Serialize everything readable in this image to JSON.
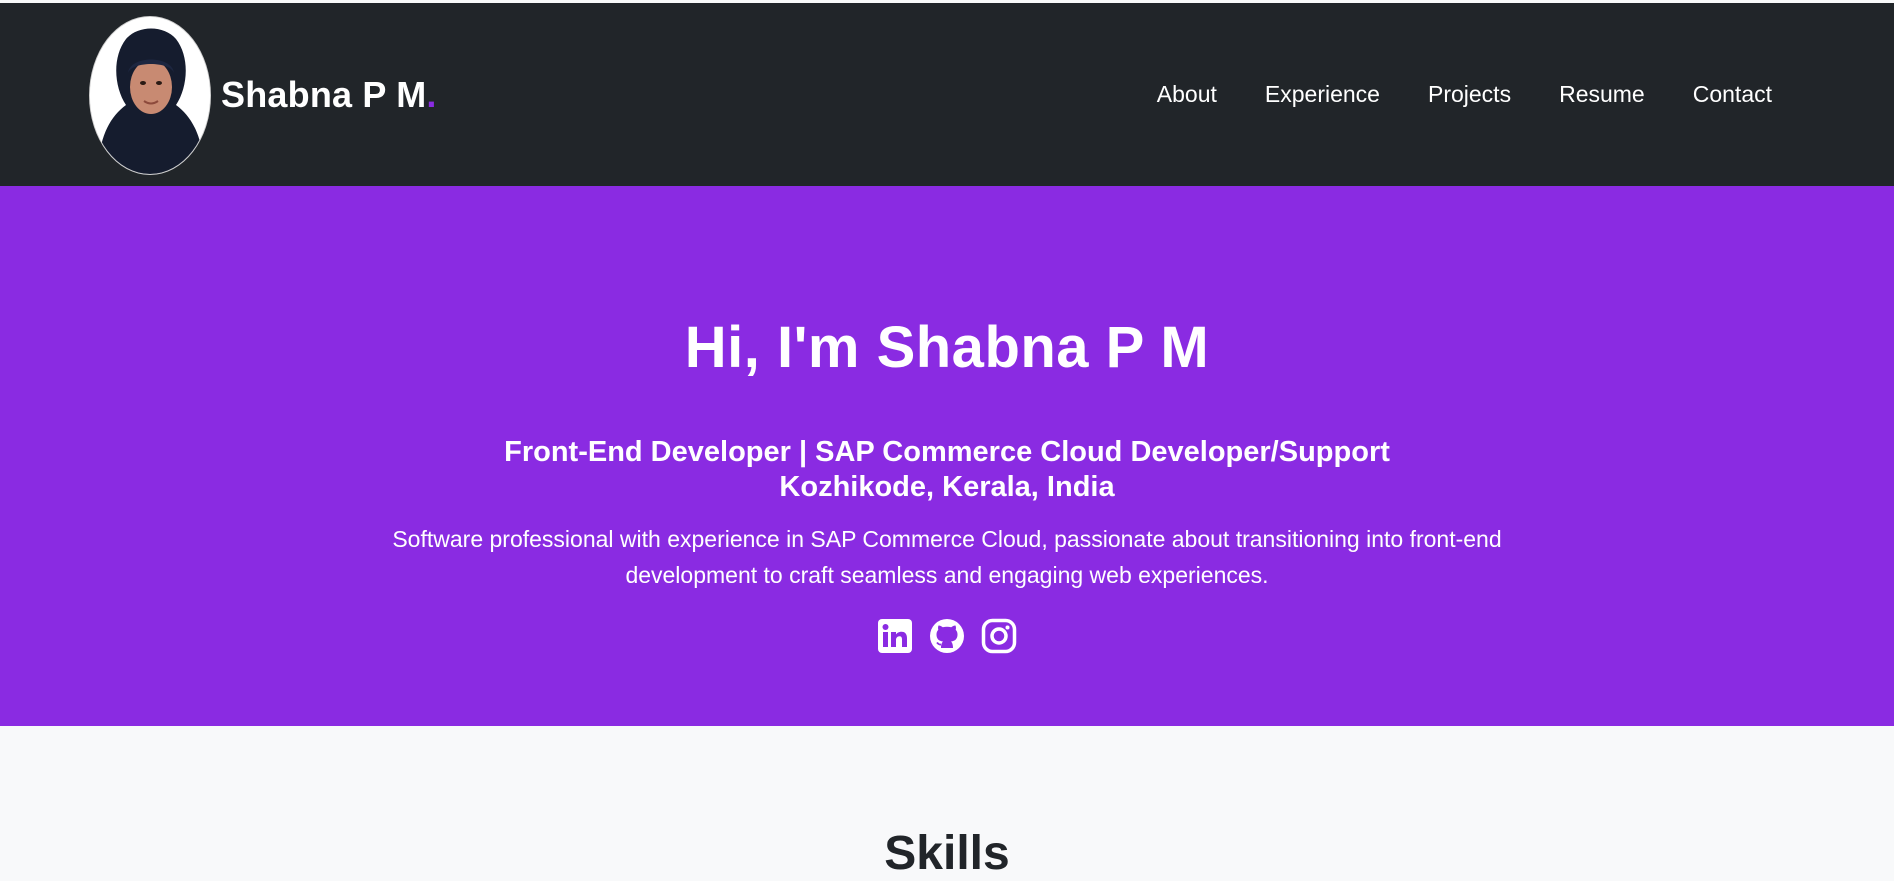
{
  "brand": {
    "name": "Shabna P M",
    "dot": "."
  },
  "nav": {
    "items": [
      {
        "label": "About"
      },
      {
        "label": "Experience"
      },
      {
        "label": "Projects"
      },
      {
        "label": "Resume"
      },
      {
        "label": "Contact"
      }
    ]
  },
  "hero": {
    "title": "Hi, I'm Shabna P M",
    "role": "Front-End Developer | SAP Commerce Cloud Developer/Support",
    "location": "Kozhikode, Kerala, India",
    "description": "Software professional with experience in SAP Commerce Cloud, passionate about transitioning into front-end development to craft seamless and engaging web experiences.",
    "socials": [
      {
        "icon": "linkedin-icon"
      },
      {
        "icon": "github-icon"
      },
      {
        "icon": "instagram-icon"
      }
    ]
  },
  "skills": {
    "title": "Skills"
  },
  "colors": {
    "navbar_bg": "#212529",
    "hero_bg": "#8a2be2",
    "accent": "#8a2be2",
    "page_bg": "#f8f9fa",
    "text_dark": "#212529"
  }
}
